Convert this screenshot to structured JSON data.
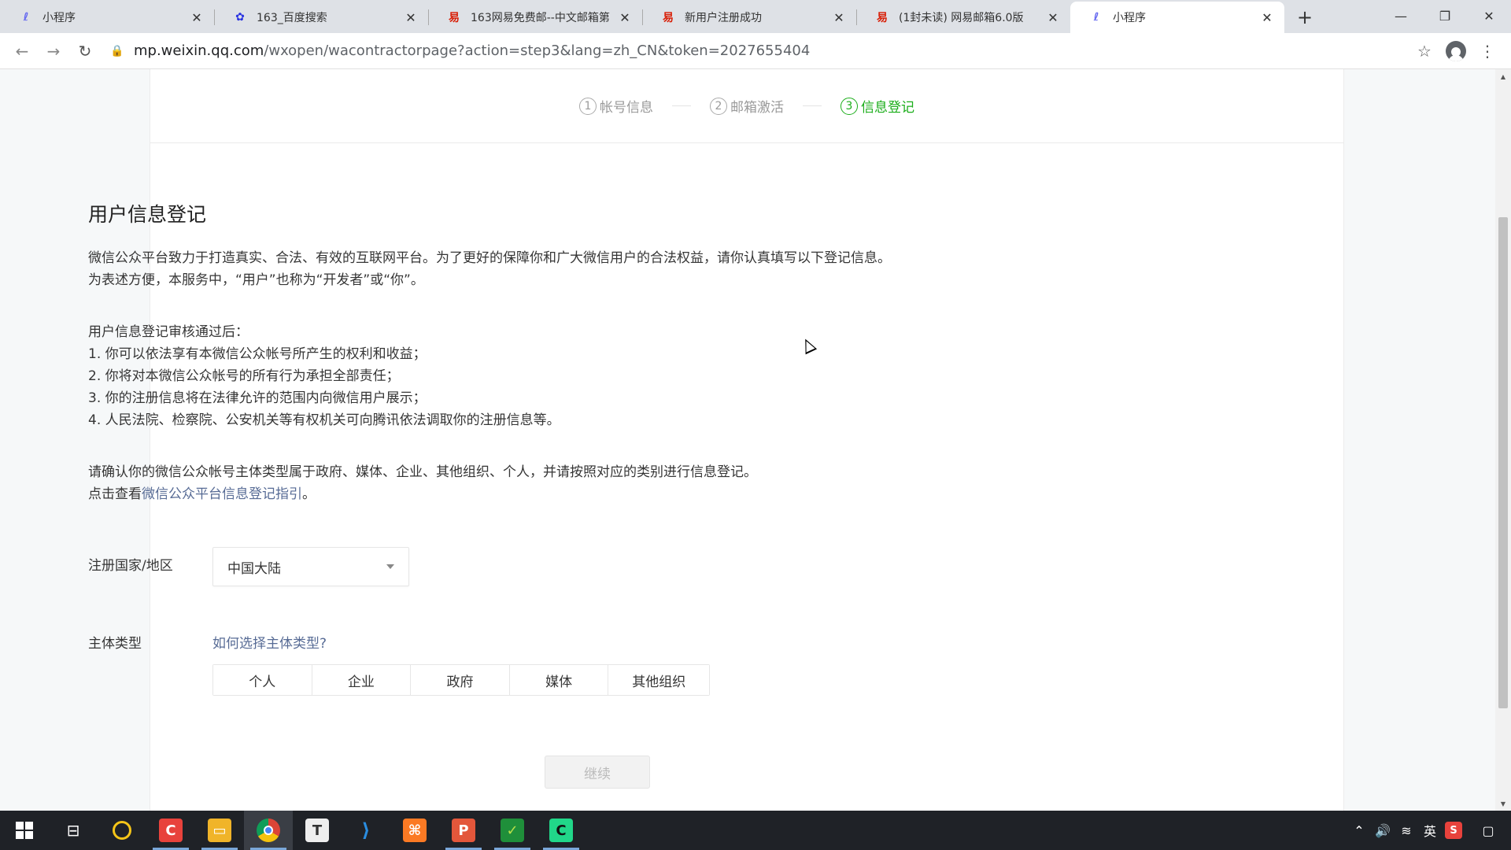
{
  "browser": {
    "tabs": [
      {
        "title": "小程序",
        "favicon": "miniprogram-icon",
        "active": false
      },
      {
        "title": "163_百度搜索",
        "favicon": "baidu-icon",
        "active": false
      },
      {
        "title": "163网易免费邮--中文邮箱第",
        "favicon": "netease-icon",
        "active": false
      },
      {
        "title": "新用户注册成功",
        "favicon": "netease-icon",
        "active": false
      },
      {
        "title": "(1封未读) 网易邮箱6.0版",
        "favicon": "netease-icon",
        "active": false
      },
      {
        "title": "小程序",
        "favicon": "miniprogram-icon",
        "active": true
      }
    ],
    "url_host": "mp.weixin.qq.com",
    "url_path": "/wxopen/wacontractorpage?action=step3&lang=zh_CN&token=2027655404"
  },
  "steps": [
    {
      "num": "1",
      "label": "帐号信息"
    },
    {
      "num": "2",
      "label": "邮箱激活"
    },
    {
      "num": "3",
      "label": "信息登记"
    }
  ],
  "page": {
    "title": "用户信息登记",
    "intro_line1": "微信公众平台致力于打造真实、合法、有效的互联网平台。为了更好的保障你和广大微信用户的合法权益，请你认真填写以下登记信息。",
    "intro_line2": "为表述方便，本服务中，“用户”也称为“开发者”或“你”。",
    "after_title": "用户信息登记审核通过后：",
    "after_items": [
      "1. 你可以依法享有本微信公众帐号所产生的权利和收益；",
      "2. 你将对本微信公众帐号的所有行为承担全部责任；",
      "3. 你的注册信息将在法律允许的范围内向微信用户展示；",
      "4. 人民法院、检察院、公安机关等有权机关可向腾讯依法调取你的注册信息等。"
    ],
    "confirm_line": "请确认你的微信公众帐号主体类型属于政府、媒体、企业、其他组织、个人，并请按照对应的类别进行信息登记。",
    "guide_prefix": "点击查看",
    "guide_link": "微信公众平台信息登记指引",
    "guide_suffix": "。"
  },
  "form": {
    "country_label": "注册国家/地区",
    "country_value": "中国大陆",
    "type_label": "主体类型",
    "type_help_link": "如何选择主体类型?",
    "type_options": [
      "个人",
      "企业",
      "政府",
      "媒体",
      "其他组织"
    ],
    "continue_label": "继续"
  },
  "taskbar": {
    "tray_ime": "英"
  }
}
